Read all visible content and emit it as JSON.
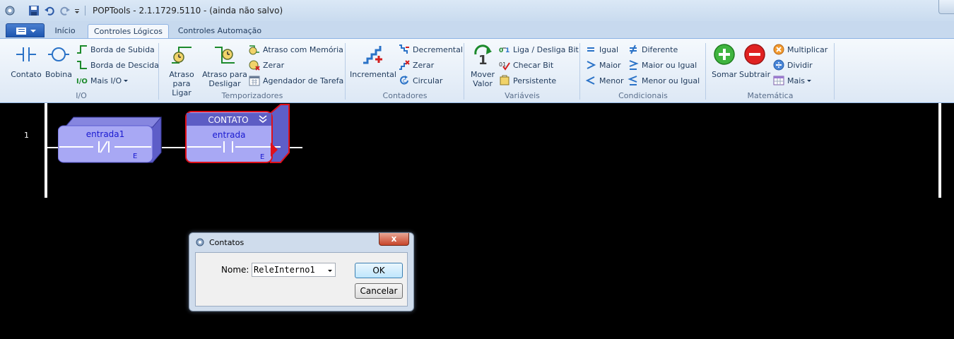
{
  "window": {
    "title": "POPTools - 2.1.1729.5110 - (ainda não salvo)"
  },
  "tabs": [
    {
      "label": "Início"
    },
    {
      "label": "Controles Lógicos"
    },
    {
      "label": "Controles Automação"
    }
  ],
  "ribbon": {
    "io": {
      "group_label": "I/O",
      "contato": "Contato",
      "bobina": "Bobina",
      "borda_subida": "Borda de Subida",
      "borda_descida": "Borda de Descida",
      "mais_io": "Mais I/O"
    },
    "temporizadores": {
      "group_label": "Temporizadores",
      "atraso_ligar": [
        "Atraso",
        "para Ligar"
      ],
      "atraso_desligar": [
        "Atraso para",
        "Desligar"
      ],
      "atraso_memoria": "Atraso com Memória",
      "zerar": "Zerar",
      "agendador": "Agendador de Tarefa"
    },
    "contadores": {
      "group_label": "Contadores",
      "incremental": "Incremental",
      "decremental": "Decremental",
      "zerar": "Zerar",
      "circular": "Circular"
    },
    "variaveis": {
      "group_label": "Variáveis",
      "mover_valor": [
        "Mover",
        "Valor"
      ],
      "liga_desliga": "Liga / Desliga Bit",
      "checar_bit": "Checar Bit",
      "persistente": "Persistente"
    },
    "condicionais": {
      "group_label": "Condicionais",
      "igual": "Igual",
      "maior": "Maior",
      "menor": "Menor",
      "diferente": "Diferente",
      "maior_igual": "Maior ou Igual",
      "menor_igual": "Menor ou Igual"
    },
    "matematica": {
      "group_label": "Matemática",
      "somar": "Somar",
      "subtrair": "Subtrair",
      "multiplicar": "Multiplicar",
      "dividir": "Dividir",
      "mais": "Mais"
    }
  },
  "ladder": {
    "rung_number": "1",
    "contacts": [
      {
        "name": "entrada1",
        "type_letter": "E"
      },
      {
        "header": "CONTATO",
        "name": "entrada",
        "type_letter": "E"
      }
    ]
  },
  "dialog": {
    "title": "Contatos",
    "close": "x",
    "name_label": "Nome:",
    "name_value": "ReleInterno1",
    "ok": "OK",
    "cancel": "Cancelar"
  },
  "colors": {
    "ribbon_text": "#1e395b",
    "contact_fill": "#a8a8f4",
    "selected_border": "#e0101a",
    "contact_text": "#1a1ad0"
  }
}
